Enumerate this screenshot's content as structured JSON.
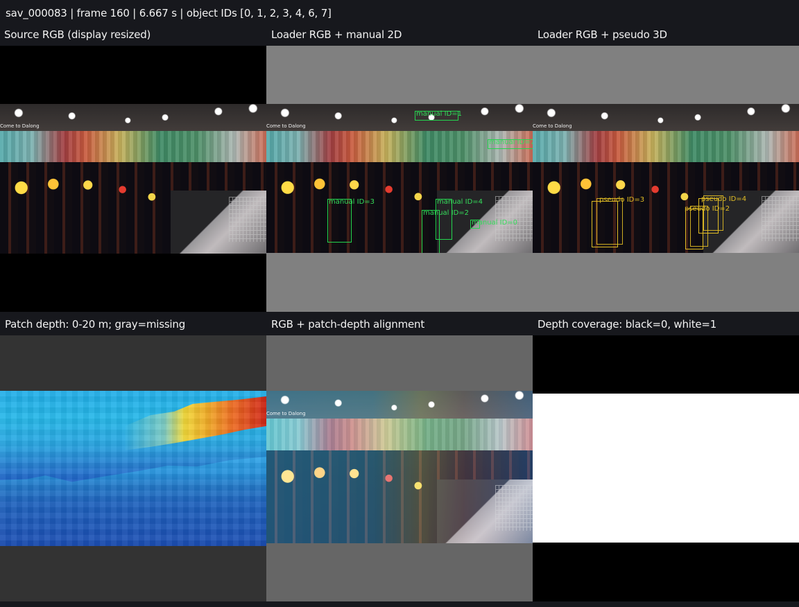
{
  "header": {
    "title": "sav_000083 | frame 160 | 6.667 s | object IDs [0, 1, 2, 3, 4, 6, 7]"
  },
  "panels": {
    "source": {
      "title": "Source RGB (display resized)",
      "sign": "Come to Dalong"
    },
    "manual": {
      "title": "Loader RGB + manual 2D",
      "labels": [
        "manual ID=1",
        "manual ID=7",
        "manual ID=3",
        "manual ID=4",
        "manual ID=2",
        "manual ID=0"
      ]
    },
    "pseudo": {
      "title": "Loader RGB + pseudo 3D",
      "labels": [
        "pseudo ID=3",
        "pseudo ID=4",
        "pseudo ID=2"
      ]
    },
    "depth": {
      "title": "Patch depth: 0-20 m; gray=missing"
    },
    "alignment": {
      "title": "RGB + patch-depth alignment"
    },
    "coverage": {
      "title": "Depth coverage: black=0, white=1"
    }
  },
  "colors": {
    "background": "#17181d",
    "manual_2d": "#24d64e",
    "pseudo_3d": "#e1bd25",
    "missing_gray": "#808080",
    "coverage_white": "#ffffff"
  }
}
